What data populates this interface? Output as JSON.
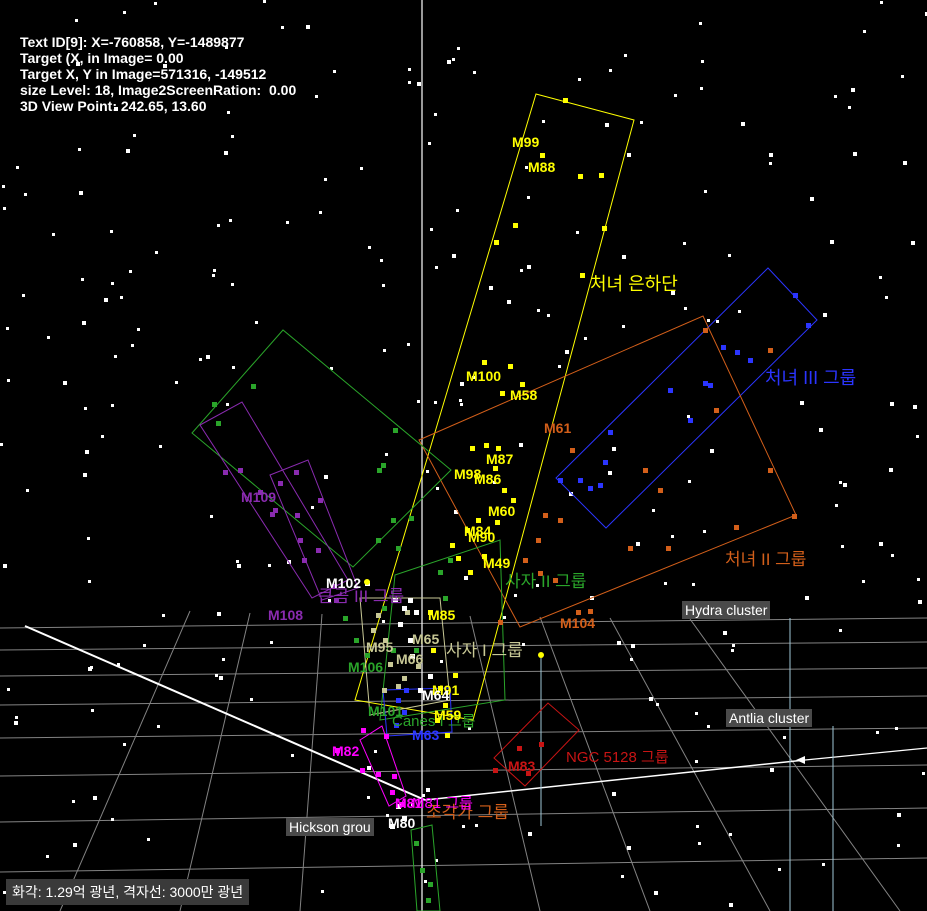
{
  "hud": {
    "lines": [
      "Text ID[9]: X=-760858, Y=-1489877",
      "Target (X, in Image= 0.00",
      "Target X, Y in Image=571316, -149512",
      "size Level: 18, Image2ScreenRation:  0.00",
      "3D View Point: 242.65, 13.60"
    ]
  },
  "status": "화각:  1.29억 광년, 격자선: 3000만 광년",
  "tags": {
    "hydra": "Hydra cluster",
    "antlia": "Antlia cluster",
    "hickson": "Hickson grou"
  },
  "colors": {
    "yellow": "#ffff00",
    "orange": "#d35f1a",
    "blue": "#2b35ff",
    "green": "#2aa52a",
    "purple": "#8a2bb0",
    "magenta": "#ff00ff",
    "darkred": "#c81414",
    "khaki": "#c8c896",
    "grid": "#bbbbbb",
    "white": "#ffffff"
  },
  "groups": [
    {
      "id": "virgo-cluster",
      "label": "처녀 은하단",
      "color": "yellow"
    },
    {
      "id": "virgo-3",
      "label": "처녀 III 그룹",
      "color": "blue"
    },
    {
      "id": "virgo-2",
      "label": "처녀 II 그룹",
      "color": "orange"
    },
    {
      "id": "leo-2",
      "label": "사자 II 그룹",
      "color": "green"
    },
    {
      "id": "leo-1",
      "label": "사자 I 그룹",
      "color": "khaki"
    },
    {
      "id": "ursa-major",
      "label": "큰곰 III 그룹",
      "color": "purple"
    },
    {
      "id": "ngc5128",
      "label": "NGC 5128 그룹",
      "color": "darkred"
    },
    {
      "id": "sculptor",
      "label": "조각가 그룹",
      "color": "orange"
    },
    {
      "id": "canes-1",
      "label": "Canes I 그룹",
      "color": "green"
    },
    {
      "id": "m81",
      "label": "M81 그룹",
      "color": "magenta"
    }
  ],
  "messier": [
    {
      "label": "M99",
      "color": "yellow"
    },
    {
      "label": "M88",
      "color": "yellow"
    },
    {
      "label": "M100",
      "color": "yellow"
    },
    {
      "label": "M58",
      "color": "yellow"
    },
    {
      "label": "M61",
      "color": "orange"
    },
    {
      "label": "M87",
      "color": "yellow"
    },
    {
      "label": "M98",
      "color": "yellow"
    },
    {
      "label": "M86",
      "color": "yellow"
    },
    {
      "label": "M60",
      "color": "yellow"
    },
    {
      "label": "M84",
      "color": "yellow"
    },
    {
      "label": "M90",
      "color": "yellow"
    },
    {
      "label": "M49",
      "color": "yellow"
    },
    {
      "label": "M109",
      "color": "purple"
    },
    {
      "label": "M102",
      "color": "white"
    },
    {
      "label": "M108",
      "color": "purple"
    },
    {
      "label": "M85",
      "color": "yellow"
    },
    {
      "label": "M104",
      "color": "orange"
    },
    {
      "label": "M95",
      "color": "khaki"
    },
    {
      "label": "M65",
      "color": "khaki"
    },
    {
      "label": "M106",
      "color": "green"
    },
    {
      "label": "M66",
      "color": "khaki"
    },
    {
      "label": "M91",
      "color": "yellow"
    },
    {
      "label": "M64",
      "color": "white"
    },
    {
      "label": "M101",
      "color": "green"
    },
    {
      "label": "M59",
      "color": "yellow"
    },
    {
      "label": "M83",
      "color": "darkred"
    },
    {
      "label": "M82",
      "color": "magenta"
    },
    {
      "label": "M81",
      "color": "magenta"
    },
    {
      "label": "M80",
      "color": "white"
    },
    {
      "label": "M63",
      "color": "blue"
    }
  ]
}
